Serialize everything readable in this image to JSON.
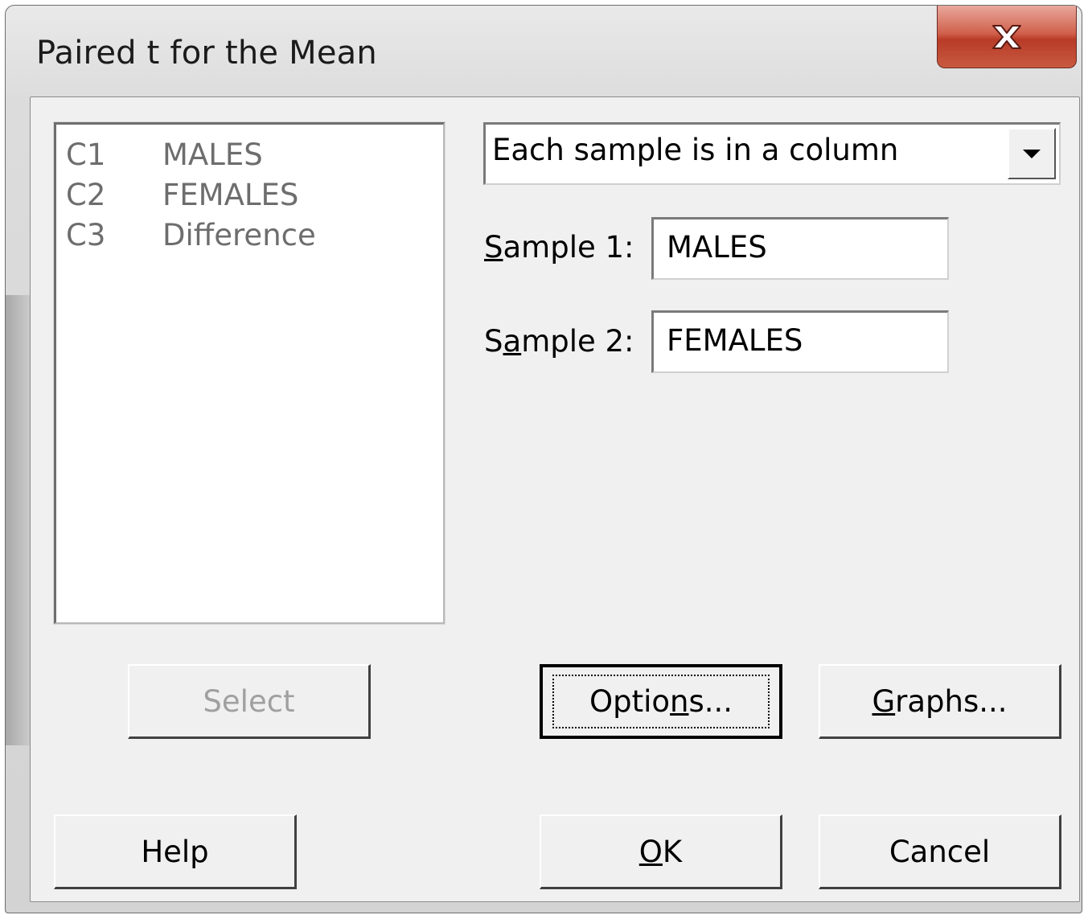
{
  "window": {
    "title": "Paired t for the Mean",
    "close_icon": "close-x-icon"
  },
  "variables": [
    {
      "col": "C1",
      "name": "MALES"
    },
    {
      "col": "C2",
      "name": "FEMALES"
    },
    {
      "col": "C3",
      "name": "Difference"
    }
  ],
  "mode_select": {
    "value": "Each sample is in a column"
  },
  "sample1": {
    "label_pre": "",
    "label_mnemonic": "S",
    "label_post": "ample 1:",
    "value": "MALES"
  },
  "sample2": {
    "label_pre": "S",
    "label_mnemonic": "a",
    "label_post": "mple 2:",
    "value": "FEMALES"
  },
  "buttons": {
    "select": "Select",
    "options_pre": "Optio",
    "options_mn": "n",
    "options_post": "s...",
    "graphs_mn": "G",
    "graphs_post": "raphs...",
    "help": "Help",
    "ok_mn": "O",
    "ok_post": "K",
    "cancel": "Cancel"
  }
}
